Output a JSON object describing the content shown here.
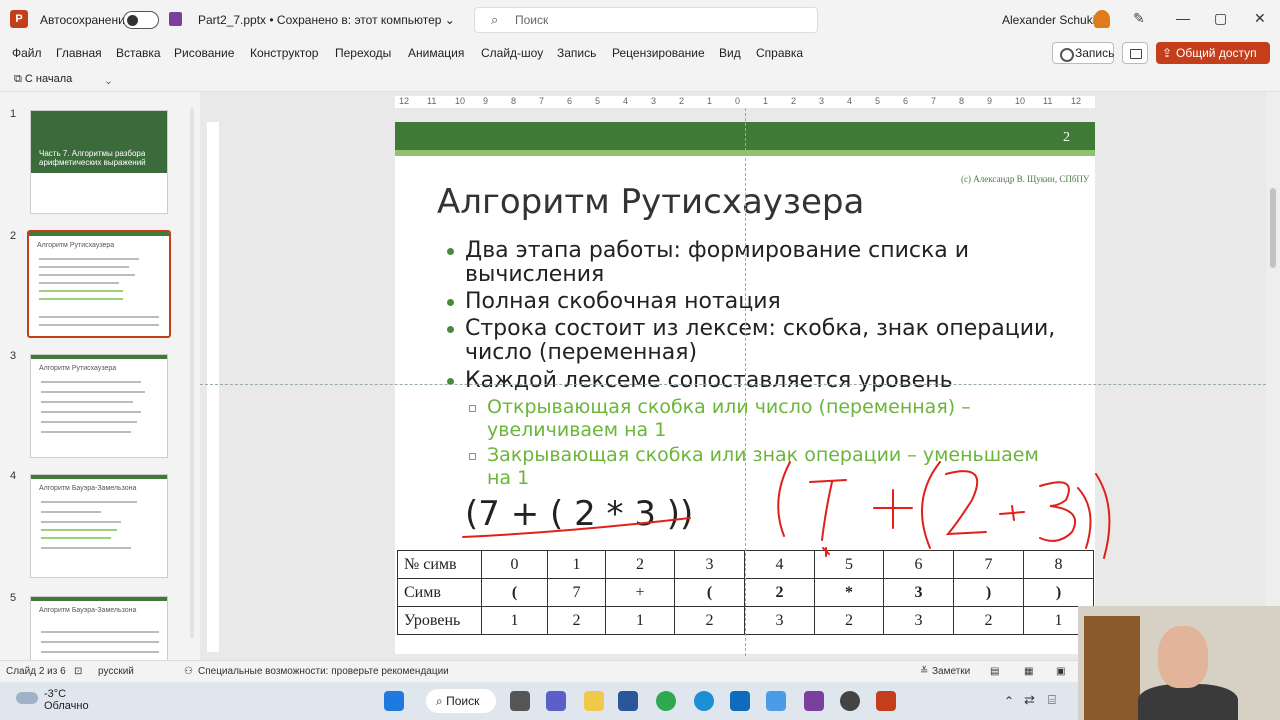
{
  "titlebar": {
    "autosave_label": "Автосохранение",
    "document_title": "Part2_7.pptx • Сохранено в: этот компьютер ⌄",
    "search_placeholder": "Поиск",
    "user_name": "Alexander Schukin",
    "window_controls": [
      "—",
      "▢",
      "✕"
    ]
  },
  "menu": {
    "items": [
      "Файл",
      "Главная",
      "Вставка",
      "Рисование",
      "Конструктор",
      "Переходы",
      "Анимация",
      "Слайд-шоу",
      "Запись",
      "Рецензирование",
      "Вид",
      "Справка"
    ],
    "record_label": "Запись",
    "share_label": "Общий доступ"
  },
  "quickbar": {
    "start_label": "С начала"
  },
  "thumbnails": [
    {
      "num": "1",
      "title": "Часть 7. Алгоритмы разбора арифметических выражений"
    },
    {
      "num": "2",
      "title": "Алгоритм Рутисхаузера"
    },
    {
      "num": "3",
      "title": "Алгоритм Рутисхаузера"
    },
    {
      "num": "4",
      "title": "Алгоритм Бауэра-Замельзона"
    },
    {
      "num": "5",
      "title": "Алгоритм Бауэра-Замельзона"
    }
  ],
  "ruler": {
    "marks": [
      "12",
      "11",
      "10",
      "9",
      "8",
      "7",
      "6",
      "5",
      "4",
      "3",
      "2",
      "1",
      "0",
      "1",
      "2",
      "3",
      "4",
      "5",
      "6",
      "7",
      "8",
      "9",
      "10",
      "11",
      "12"
    ]
  },
  "slide": {
    "number": "2",
    "copyright": "(c) Александр В. Щукин, СПбПУ",
    "title": "Алгоритм Рутисхаузера",
    "bullets": [
      "Два этапа работы: формирование списка и вычисления",
      "Полная скобочная нотация",
      "Строка состоит из лексем: скобка, знак операции, число (переменная)",
      "Каждой лексеме сопоставляется уровень"
    ],
    "subbullets": [
      "Открывающая скобка или число (переменная) – увеличиваем на 1",
      "Закрывающая скобка или знак операции – уменьшаем на 1"
    ],
    "expression": "(7 + ( 2 * 3 ))",
    "table": {
      "row_headers": [
        "№ симв",
        "Симв",
        "Уровень"
      ],
      "positions": [
        "0",
        "1",
        "2",
        "3",
        "4",
        "5",
        "6",
        "7",
        "8"
      ],
      "symbols": [
        "(",
        "7",
        "+",
        "(",
        "2",
        "*",
        "3",
        ")",
        ")"
      ],
      "levels": [
        "1",
        "2",
        "1",
        "2",
        "3",
        "2",
        "3",
        "2",
        "1"
      ]
    }
  },
  "status": {
    "slide_info": "Слайд 2 из 6",
    "language": "русский",
    "accessibility": "Специальные возможности: проверьте рекомендации",
    "notes": "Заметки"
  },
  "taskbar": {
    "temperature": "-3°C",
    "weather": "Облачно",
    "search_label": "Поиск"
  },
  "colors": {
    "accent": "#c43e1c",
    "slide_green": "#3f7a36",
    "sub_green": "#6bb53b",
    "ink_red": "#e0201a"
  }
}
